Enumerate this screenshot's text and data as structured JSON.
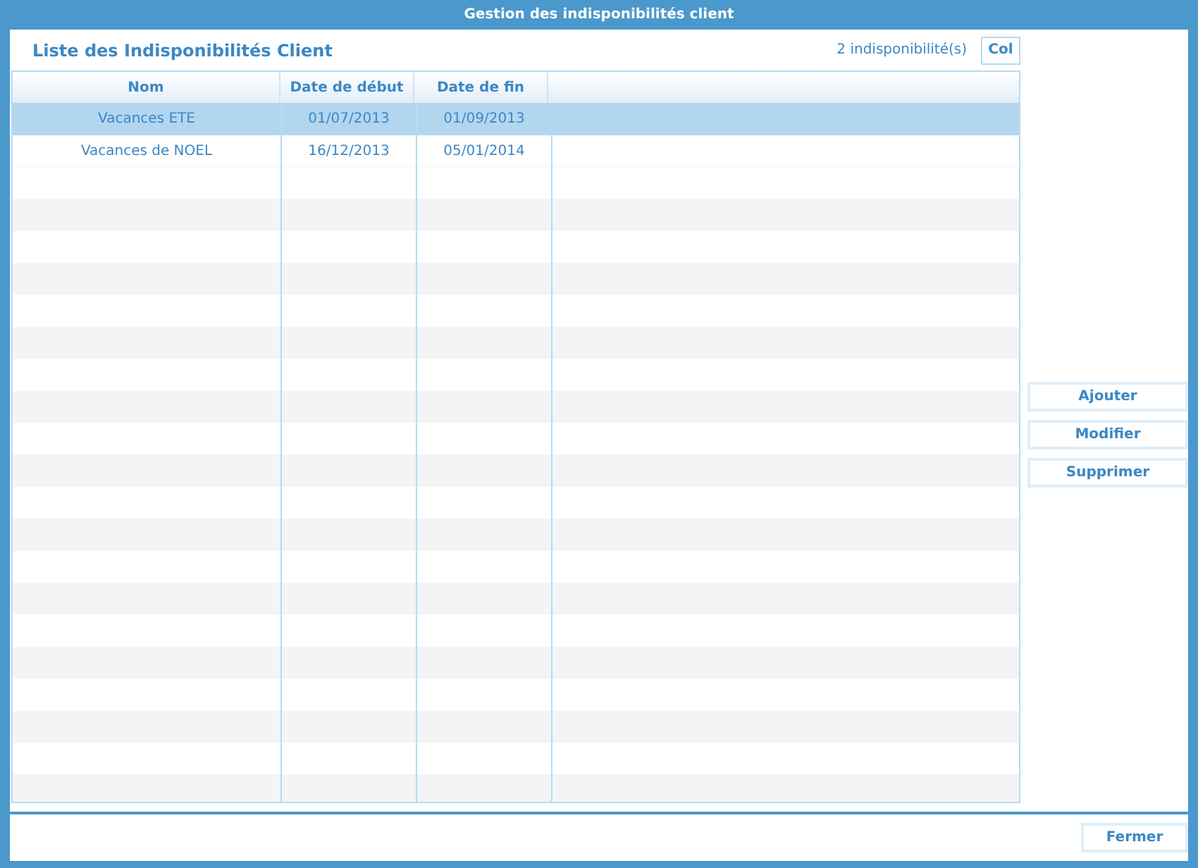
{
  "window": {
    "title": "Gestion des indisponibilités client"
  },
  "list_title": "Liste des Indisponibilités Client",
  "count": "2 indisponibilité(s)",
  "col_button": "Col",
  "table": {
    "columns": [
      "Nom",
      "Date de début",
      "Date de fin"
    ],
    "rows": [
      {
        "cells": [
          "Vacances ETE",
          "01/07/2013",
          "01/09/2013"
        ],
        "selected": true
      },
      {
        "cells": [
          "Vacances de NOEL",
          "16/12/2013",
          "05/01/2014"
        ],
        "selected": false
      }
    ]
  },
  "actions": [
    "Ajouter",
    "Modifier",
    "Supprimer"
  ],
  "footer": {
    "close": "Fermer"
  }
}
